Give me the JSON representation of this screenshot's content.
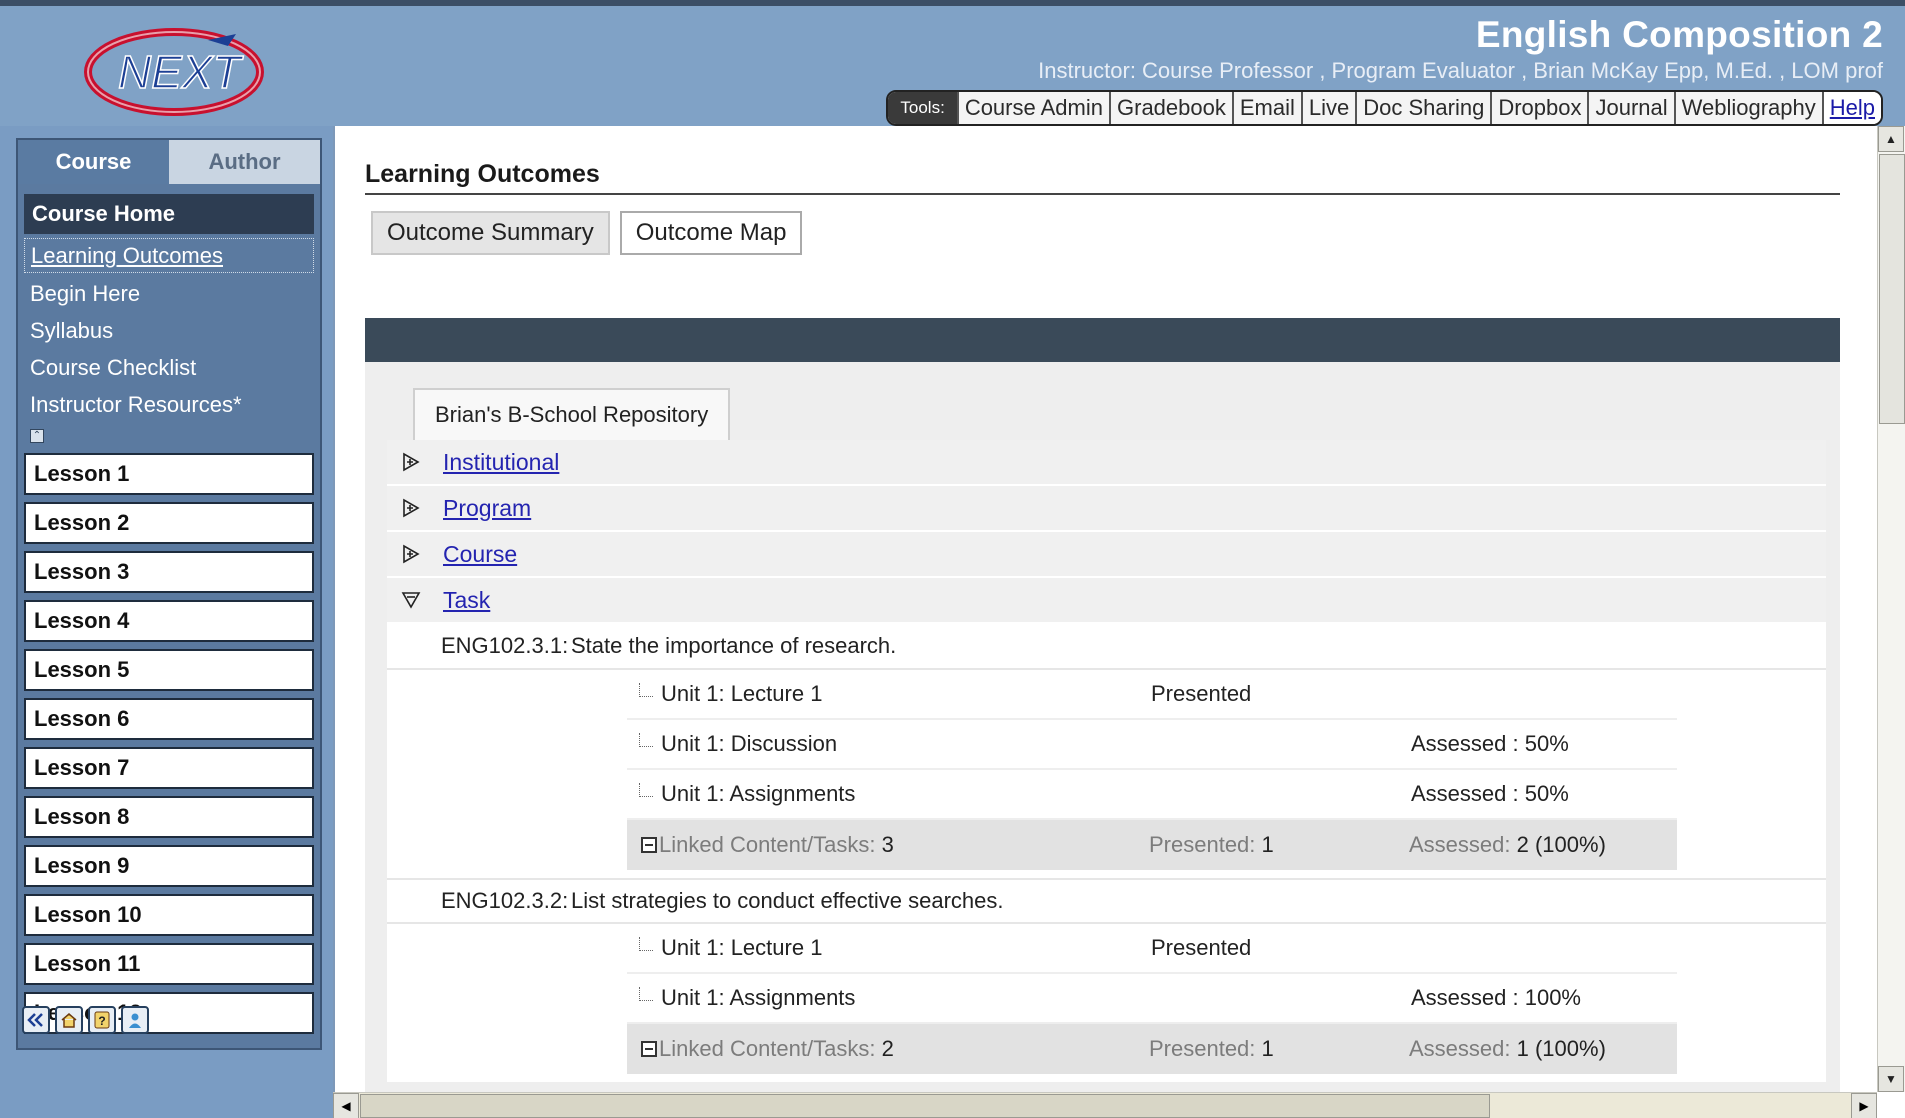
{
  "header": {
    "course_title": "English Composition 2",
    "instructor": "Instructor:  Course Professor , Program Evaluator , Brian McKay Epp, M.Ed. , LOM prof",
    "tools_label": "Tools:",
    "tools": [
      "Course Admin",
      "Gradebook",
      "Email",
      "Live",
      "Doc Sharing",
      "Dropbox",
      "Journal",
      "Webliography",
      "Help"
    ],
    "logo_text": "NEXT"
  },
  "sidebar": {
    "tabs": [
      {
        "label": "Course"
      },
      {
        "label": "Author"
      }
    ],
    "course_home": "Course Home",
    "links": [
      {
        "label": "Learning Outcomes"
      },
      {
        "label": "Begin Here"
      },
      {
        "label": "Syllabus"
      },
      {
        "label": "Course Checklist"
      },
      {
        "label": "Instructor Resources*"
      }
    ],
    "lessons": [
      "Lesson 1",
      "Lesson 2",
      "Lesson 3",
      "Lesson 4",
      "Lesson 5",
      "Lesson 6",
      "Lesson 7",
      "Lesson 8",
      "Lesson 9",
      "Lesson 10",
      "Lesson 11",
      "Lesson 12"
    ]
  },
  "main": {
    "title": "Learning Outcomes",
    "buttons": [
      "Outcome Summary",
      "Outcome Map"
    ],
    "repo_tab": "Brian's B-School Repository",
    "categories": [
      "Institutional",
      "Program",
      "Course",
      "Task"
    ],
    "outcomes": [
      {
        "code": "ENG102.3.1:",
        "text": "State the importance of research.",
        "links": [
          {
            "name": "Unit  1: Lecture 1",
            "presented": "Presented",
            "assessed": ""
          },
          {
            "name": "Unit  1: Discussion",
            "presented": "",
            "assessed": "Assessed : 50%"
          },
          {
            "name": "Unit  1: Assignments",
            "presented": "",
            "assessed": "Assessed : 50%"
          }
        ],
        "summary": {
          "linked_label": "Linked Content/Tasks:",
          "linked_value": "3",
          "presented_label": "Presented:",
          "presented_value": "1",
          "assessed_label": "Assessed:",
          "assessed_value": "2 (100%)"
        }
      },
      {
        "code": "ENG102.3.2:",
        "text": "List strategies to conduct effective searches.",
        "links": [
          {
            "name": "Unit  1: Lecture 1",
            "presented": "Presented",
            "assessed": ""
          },
          {
            "name": "Unit  1: Assignments",
            "presented": "",
            "assessed": "Assessed : 100%"
          }
        ],
        "summary": {
          "linked_label": "Linked Content/Tasks:",
          "linked_value": "2",
          "presented_label": "Presented:",
          "presented_value": "1",
          "assessed_label": "Assessed:",
          "assessed_value": "1 (100%)"
        }
      }
    ]
  },
  "colors": {
    "header_bg": "#80a2c6",
    "sidebar_bg": "#5b7aa0",
    "dark_band": "#3a4a59",
    "link": "#2424b0"
  }
}
